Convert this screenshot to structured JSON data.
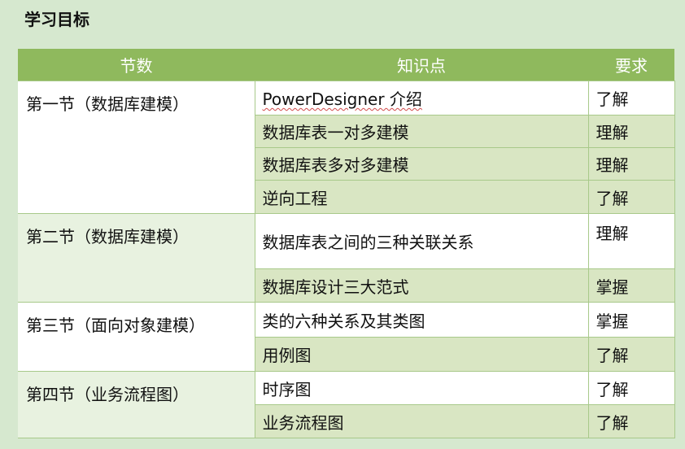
{
  "heading": "学习目标",
  "table": {
    "headers": [
      "节数",
      "知识点",
      "要求"
    ],
    "sections": [
      {
        "name": "第一节（数据库建模）",
        "rows": [
          {
            "topic": "PowerDesigner 介绍",
            "req": "了解"
          },
          {
            "topic": "数据库表一对多建模",
            "req": "理解"
          },
          {
            "topic": "数据库表多对多建模",
            "req": "理解"
          },
          {
            "topic": "逆向工程",
            "req": "了解"
          }
        ]
      },
      {
        "name": "第二节（数据库建模）",
        "rows": [
          {
            "topic": "数据库表之间的三种关联关系",
            "req": "理解"
          },
          {
            "topic": "数据库设计三大范式",
            "req": "掌握"
          }
        ]
      },
      {
        "name": "第三节（面向对象建模）",
        "rows": [
          {
            "topic": "类的六种关系及其类图",
            "req": "掌握"
          },
          {
            "topic": "用例图",
            "req": "了解"
          }
        ]
      },
      {
        "name": "第四节（业务流程图）",
        "rows": [
          {
            "topic": "时序图",
            "req": "了解"
          },
          {
            "topic": "业务流程图",
            "req": "了解"
          }
        ]
      }
    ]
  }
}
